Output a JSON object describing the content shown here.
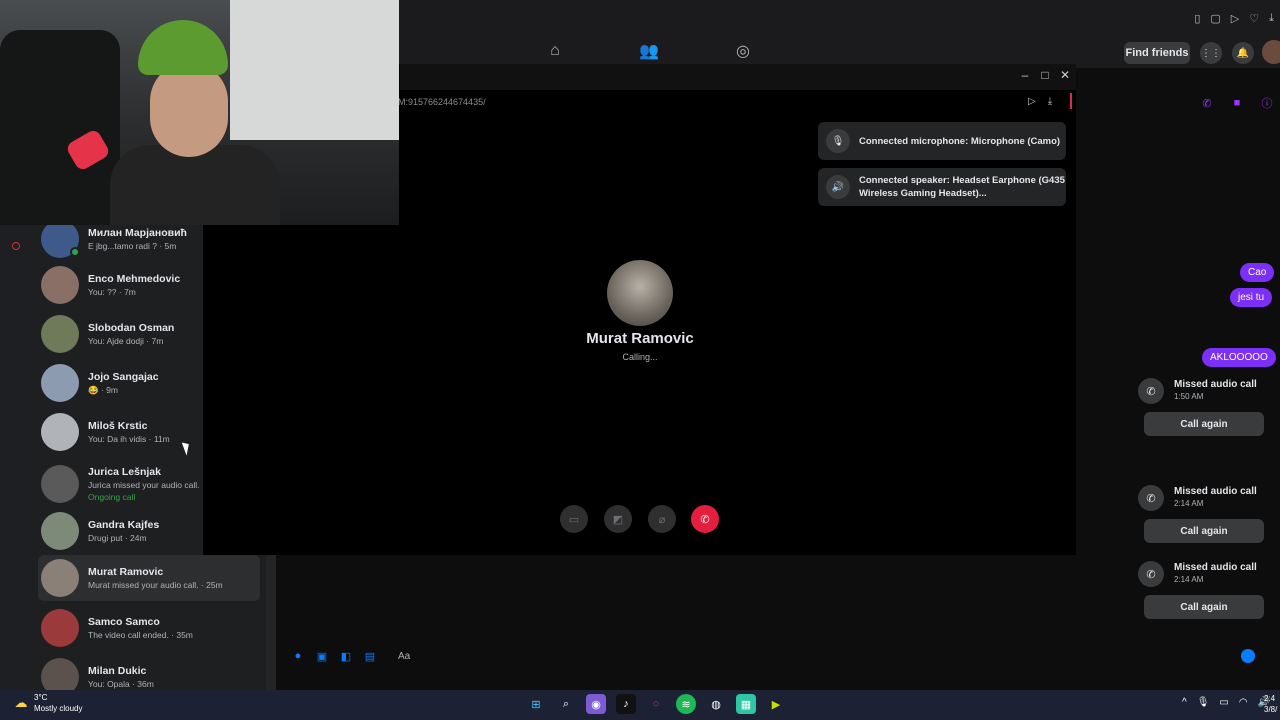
{
  "header": {
    "find_friends": "Find friends"
  },
  "call": {
    "url": "M:915766244674435/",
    "callee_name": "Murat Ramovic",
    "status": "Calling...",
    "toasts": [
      {
        "icon": "microphone-icon",
        "text": "Connected microphone: Microphone (Camo)"
      },
      {
        "icon": "speaker-icon",
        "text": "Connected speaker: Headset Earphone (G435 Wireless Gaming Headset)..."
      }
    ]
  },
  "chats": [
    {
      "name": "Милан Марјановић",
      "sub": "E jbg...tamo radi ? · 5m",
      "online": true
    },
    {
      "name": "Enco Mehmedovic",
      "sub": "You: ?? · 7m"
    },
    {
      "name": "Slobodan Osman",
      "sub": "You: Ajde dodji · 7m"
    },
    {
      "name": "Jojo Sangajac",
      "sub": "😂 · 9m"
    },
    {
      "name": "Miloš Krstic",
      "sub": "You: Da ih vidis · 11m"
    },
    {
      "name": "Jurica Lešnjak",
      "sub": "Jurica missed your audio call.",
      "sub2": "Ongoing call"
    },
    {
      "name": "Gandra Kajfes",
      "sub": "Drugi put · 24m"
    },
    {
      "name": "Murat Ramovic",
      "sub": "Murat missed your audio call. · 25m",
      "active": true
    },
    {
      "name": "Samco Samco",
      "sub": "The video call ended. · 35m"
    },
    {
      "name": "Milan Dukic",
      "sub": "You: Opala · 36m"
    }
  ],
  "conversation": {
    "input_placeholder": "Aa",
    "messages": [
      "Cao",
      "jesi tu",
      "AKLOOOOO"
    ],
    "missed_calls": [
      {
        "title": "Missed audio call",
        "time": "1:50 AM",
        "button": "Call again"
      },
      {
        "title": "Missed audio call",
        "time": "2:14 AM",
        "button": "Call again"
      },
      {
        "title": "Missed audio call",
        "time": "2:14 AM",
        "button": "Call again"
      }
    ]
  },
  "taskbar": {
    "temperature": "3°C",
    "weather": "Mostly cloudy",
    "time": "2:4",
    "date": "3/8/"
  },
  "colors": {
    "accent": "#7b2ff7",
    "end_call": "#e41e3f",
    "online": "#31a24c"
  }
}
